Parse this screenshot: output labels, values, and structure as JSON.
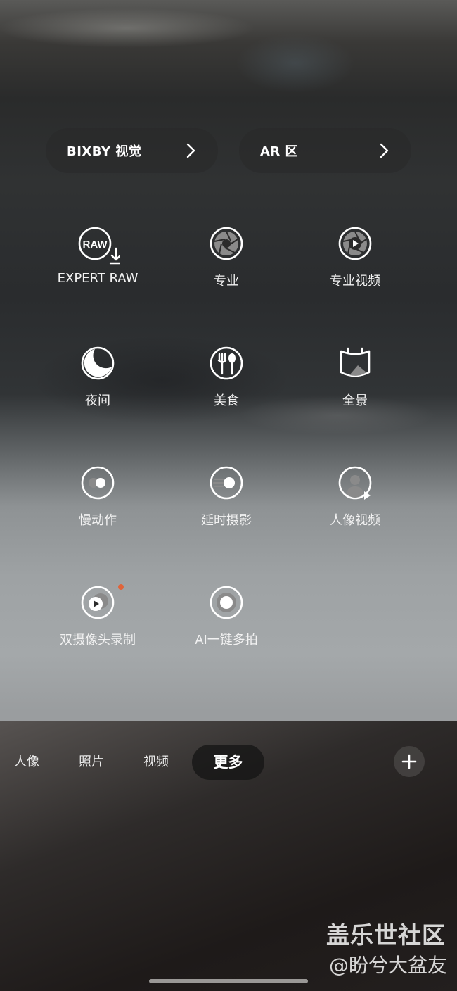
{
  "shortcuts": {
    "bixby": "BIXBY 视觉",
    "ar": "AR 区"
  },
  "modes": [
    {
      "label": "EXPERT RAW",
      "icon": "raw-download-icon",
      "badge_text": "RAW",
      "new_indicator": false
    },
    {
      "label": "专业",
      "icon": "aperture-icon",
      "new_indicator": false
    },
    {
      "label": "专业视频",
      "icon": "aperture-play-icon",
      "new_indicator": false
    },
    {
      "label": "夜间",
      "icon": "moon-icon",
      "new_indicator": false
    },
    {
      "label": "美食",
      "icon": "fork-spoon-icon",
      "new_indicator": false
    },
    {
      "label": "全景",
      "icon": "panorama-icon",
      "new_indicator": false
    },
    {
      "label": "慢动作",
      "icon": "slow-motion-icon",
      "new_indicator": false
    },
    {
      "label": "延时摄影",
      "icon": "hyperlapse-icon",
      "new_indicator": false
    },
    {
      "label": "人像视频",
      "icon": "portrait-video-icon",
      "new_indicator": false
    },
    {
      "label": "双摄像头录制",
      "icon": "dual-camera-record-icon",
      "new_indicator": true
    },
    {
      "label": "AI一键多拍",
      "icon": "single-take-icon",
      "new_indicator": false
    }
  ],
  "tabs": [
    {
      "label": "人像"
    },
    {
      "label": "照片"
    },
    {
      "label": "视频"
    },
    {
      "label": "更多",
      "active": true
    }
  ],
  "colors": {
    "new_indicator": "#e0643a",
    "icon_stroke": "#ffffff"
  },
  "watermark": {
    "site": "盖乐世社区",
    "user": "@盼兮大盆友"
  }
}
